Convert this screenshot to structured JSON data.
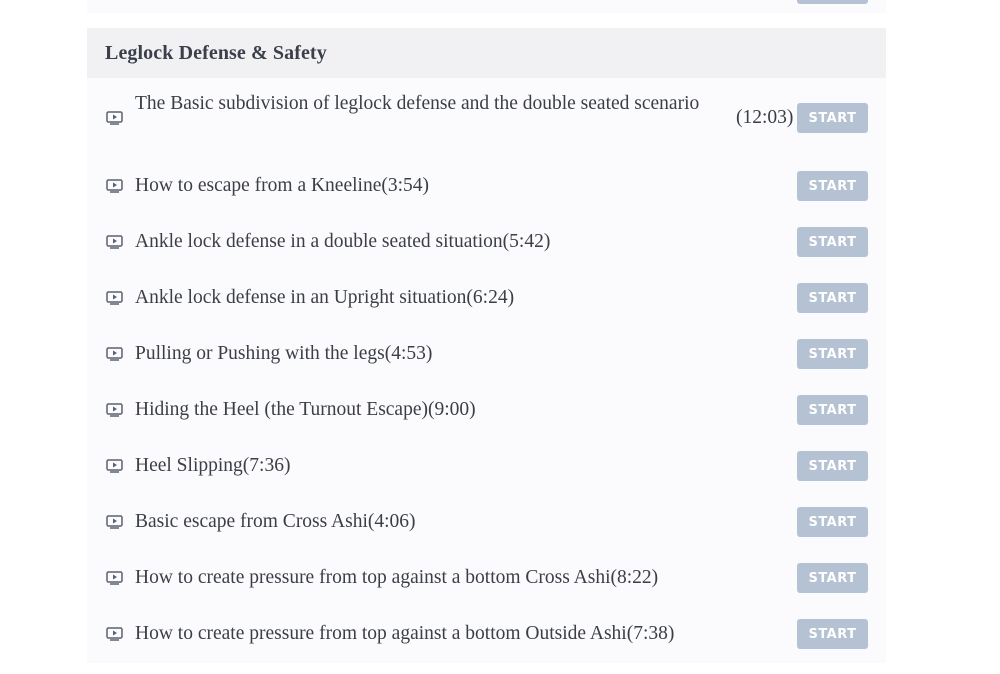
{
  "section": {
    "title": "Leglock Defense & Safety",
    "start_label": "START",
    "lessons": [
      {
        "title": "The Basic subdivision of leglock defense and the double seated scenario",
        "duration": "(12:03)"
      },
      {
        "title": "How to escape from a Kneeline(3:54)"
      },
      {
        "title": "Ankle lock defense in a double seated situation(5:42)"
      },
      {
        "title": "Ankle lock defense in an Upright situation(6:24)"
      },
      {
        "title": "Pulling or Pushing with the legs(4:53)"
      },
      {
        "title": "Hiding the Heel (the Turnout Escape)(9:00)"
      },
      {
        "title": "Heel Slipping(7:36)"
      },
      {
        "title": "Basic escape from Cross Ashi(4:06)"
      },
      {
        "title": "How to create pressure from top against a bottom Cross Ashi(8:22)"
      },
      {
        "title": "How to create pressure from top against a bottom Outside Ashi(7:38)"
      }
    ]
  },
  "icons": {
    "lesson_icon": "video-play-icon"
  },
  "colors": {
    "start_button": "#b5c2d3",
    "header_bg": "#f1f1f4",
    "text": "#3a3e46"
  }
}
